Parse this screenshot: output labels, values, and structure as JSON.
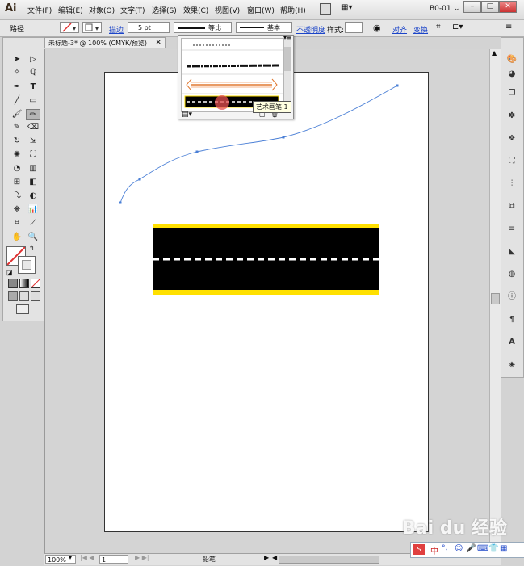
{
  "app": {
    "logo": "Ai",
    "workspace": "B0-01"
  },
  "menu": [
    "文件(F)",
    "编辑(E)",
    "对象(O)",
    "文字(T)",
    "选择(S)",
    "效果(C)",
    "视图(V)",
    "窗口(W)",
    "帮助(H)"
  ],
  "window_controls": {
    "minimize": "–",
    "maximize": "□",
    "close": "✕"
  },
  "control": {
    "selection_label": "路径",
    "stroke_label": "描边",
    "stroke_weight": "5 pt",
    "profile_label": "等比",
    "brush_label": "基本",
    "opacity_label": "不透明度",
    "style_label": "样式:",
    "align_label": "对齐",
    "transform_label": "变换"
  },
  "document": {
    "tab_title": "未标题-3* @ 100% (CMYK/预览)",
    "tab_close": "×"
  },
  "brush_tooltip": "艺术画笔 1",
  "status": {
    "zoom": "100%",
    "page": "1",
    "tool_name": "铅笔"
  },
  "ime": {
    "lang": "中",
    "punct": "°,"
  },
  "watermark": "Bai du 经验",
  "colors": {
    "road": "#000000",
    "road_edge": "#ffe000",
    "path": "#4a7fd6",
    "accent_red": "#e03030"
  }
}
